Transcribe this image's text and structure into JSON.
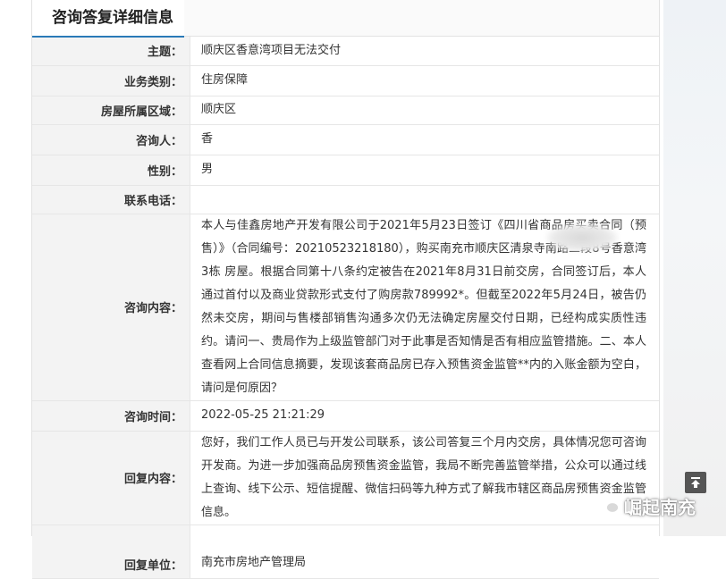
{
  "panel": {
    "title": "咨询答复详细信息"
  },
  "rows": {
    "subject": {
      "label": "主题：",
      "value": "顺庆区香意湾项目无法交付"
    },
    "category": {
      "label": "业务类别：",
      "value": "住房保障"
    },
    "district": {
      "label": "房屋所属区域：",
      "value": "顺庆区"
    },
    "person": {
      "label": "咨询人：",
      "value": "香"
    },
    "gender": {
      "label": "性别：",
      "value": "男"
    },
    "phone": {
      "label": "联系电话：",
      "value": ""
    },
    "content": {
      "label": "咨询内容：",
      "value": "本人与佳鑫房地产开发有限公司于2021年5月23日签订《四川省商品房买卖合同（预售）》（合同编号：20210523218180），购买南充市顺庆区清泉寺南路二段8号香意湾3栋          房屋。根据合同第十八条约定被告在2021年8月31日前交房，合同签订后，本人通过首付以及商业贷款形式支付了购房款789992*。但截至2022年5月24日，被告仍然未交房，期间与售楼部销售沟通多次仍无法确定房屋交付日期，已经构成实质性违约。请问一、贵局作为上级监管部门对于此事是否知情是否有相应监管措施。二、本人查看网上合同信息摘要，发现该套商品房已存入预售资金监管**内的入账金额为空白，请问是何原因？"
    },
    "time": {
      "label": "咨询时间：",
      "value": "2022-05-25 21:21:29"
    },
    "reply": {
      "label": "回复内容：",
      "value": "您好，我们工作人员已与开发公司联系，该公司答复三个月内交房，具体情况您可咨询开发商。为进一步加强商品房预售资金监管，我局不断完善监管举措，公众可以通过线上查询、线下公示、短信提醒、微信扫码等九种方式了解我市辖区商品房预售资金监管信息。"
    },
    "unit": {
      "label": "回复单位：",
      "value": "南充市房地产管理局"
    }
  },
  "watermark": {
    "text": "崛起南充",
    "icon": "wechat-icon"
  },
  "colors": {
    "accent": "#2a7ab8",
    "label_bg": "#f3f3f3",
    "border": "#e6e6e6"
  }
}
